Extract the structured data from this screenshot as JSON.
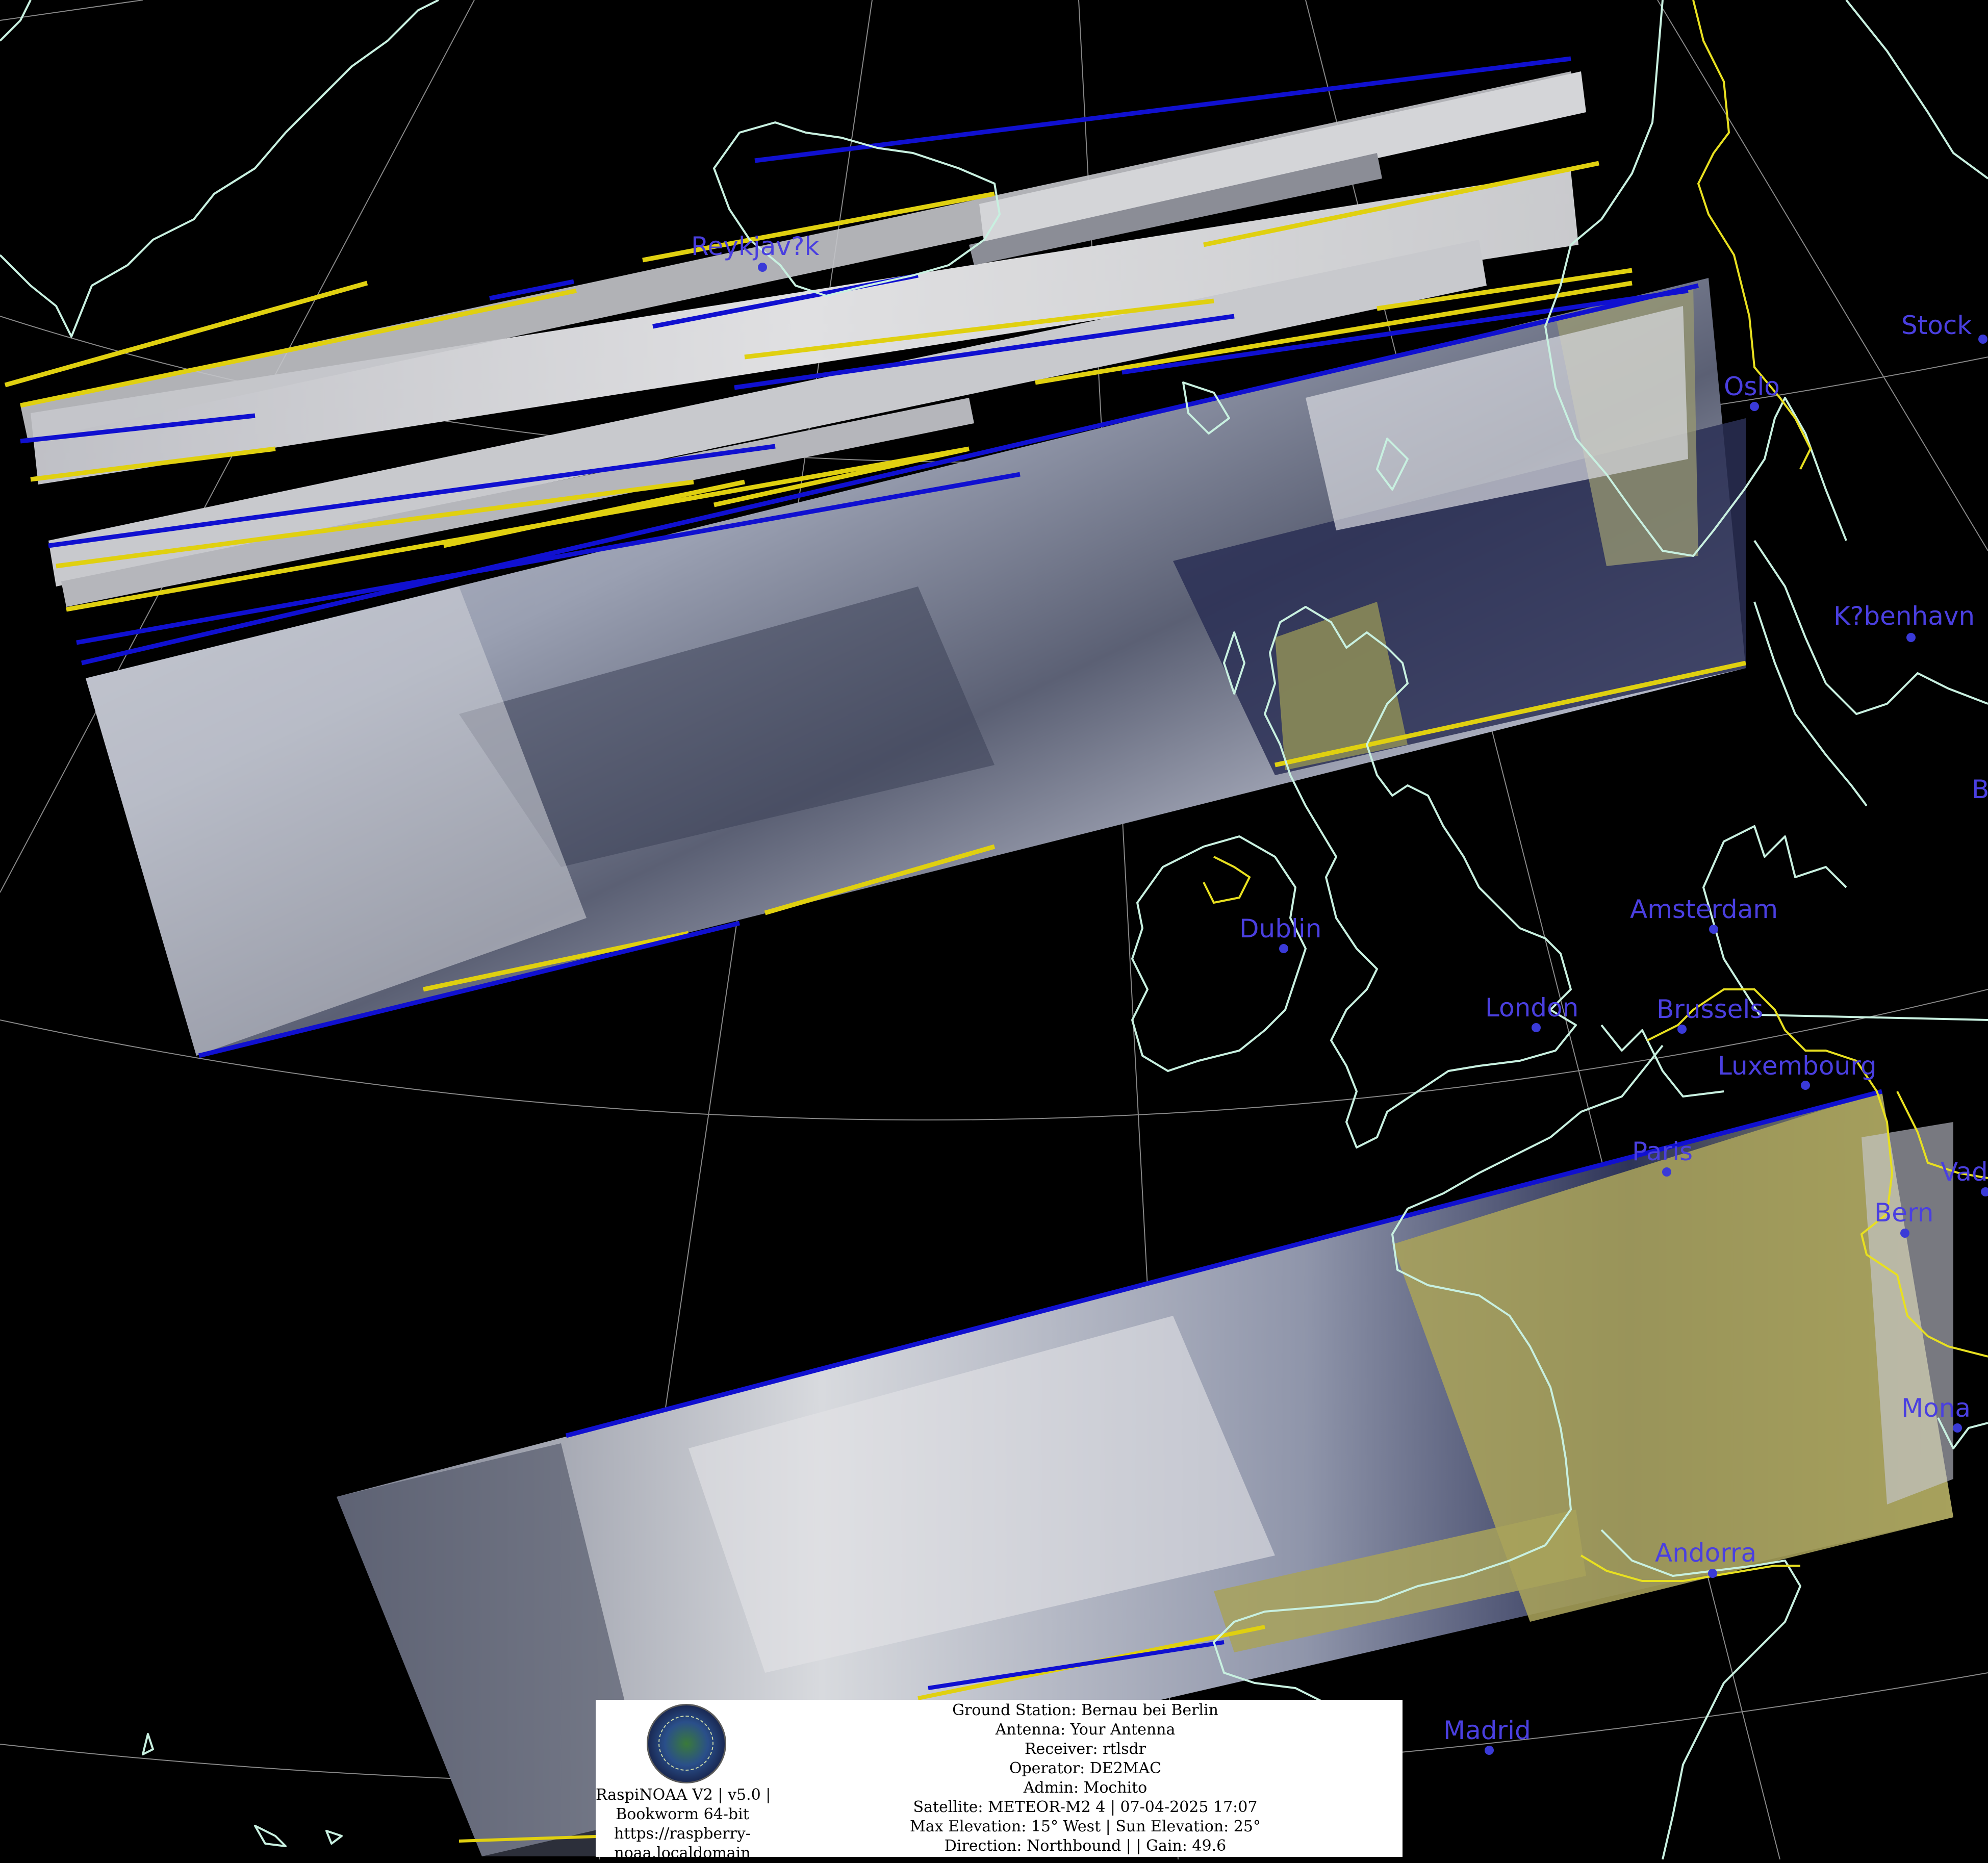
{
  "map": {
    "cities": [
      {
        "name": "Reykjav?k"
      },
      {
        "name": "Stock"
      },
      {
        "name": "Oslo"
      },
      {
        "name": "K?benhavn"
      },
      {
        "name": "Amsterdam"
      },
      {
        "name": "Dublin"
      },
      {
        "name": "London"
      },
      {
        "name": "Brussels"
      },
      {
        "name": "Luxembourg"
      },
      {
        "name": "Paris"
      },
      {
        "name": "Bern"
      },
      {
        "name": "Vad"
      },
      {
        "name": "Mona"
      },
      {
        "name": "Andorra"
      },
      {
        "name": "Madrid"
      },
      {
        "name": "B"
      }
    ],
    "colors": {
      "background": "#000000",
      "coastline": "#c8f0e0",
      "border": "#e8e020",
      "graticule": "#888888",
      "city_label": "#4a3fe0",
      "scan_blue": "#1010d0",
      "scan_yellow": "#e0d010"
    }
  },
  "info_box": {
    "logo_icon": "raspinoaa-logo-icon",
    "station_lines": [
      "RaspiNOAA V2 | v5.0 |",
      "Bookworm 64-bit",
      "https://raspberry-",
      "noaa.localdomain"
    ],
    "pass_lines": [
      "Ground Station: Bernau bei Berlin",
      "Antenna: Your Antenna",
      "Receiver: rtlsdr",
      "Operator: DE2MAC",
      "Admin: Mochito",
      "Satellite: METEOR-M2 4 | 07-04-2025 17:07",
      "Max Elevation: 15° West | Sun Elevation: 25°",
      "Direction: Northbound | | Gain: 49.6"
    ]
  }
}
